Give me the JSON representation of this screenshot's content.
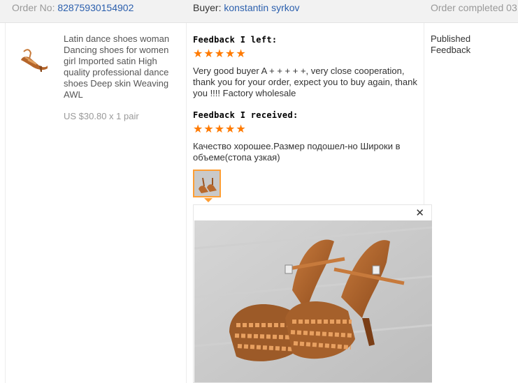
{
  "header": {
    "order_label": "Order No: ",
    "order_number": "82875930154902",
    "buyer_label": "Buyer: ",
    "buyer_name": "konstantin syrkov",
    "status": "Order completed 03"
  },
  "product": {
    "title": "Latin dance shoes woman Dancing shoes for women girl Imported satin High quality professional dance shoes Deep skin Weaving AWL",
    "price": "US $30.80 x 1 pair",
    "thumb_icon": "dance-shoe-photo"
  },
  "feedback_left": {
    "heading": "Feedback I left:",
    "stars": 5,
    "text": "Very good buyer A + + + + +, very close cooperation, thank you for your order, expect you to buy again, thank you !!!! Factory wholesale"
  },
  "feedback_received": {
    "heading": "Feedback I received:",
    "stars": 5,
    "text": "Качество хорошее.Размер подошел-но Широки в объеме(стопа узкая)",
    "photo_count": 1
  },
  "status_column": {
    "text": "Published Feedback"
  },
  "colors": {
    "star": "#ff7a00",
    "link": "#2b5fad",
    "thumb_border": "#ff9e33"
  },
  "icons": {
    "star": "★",
    "close": "✕"
  }
}
